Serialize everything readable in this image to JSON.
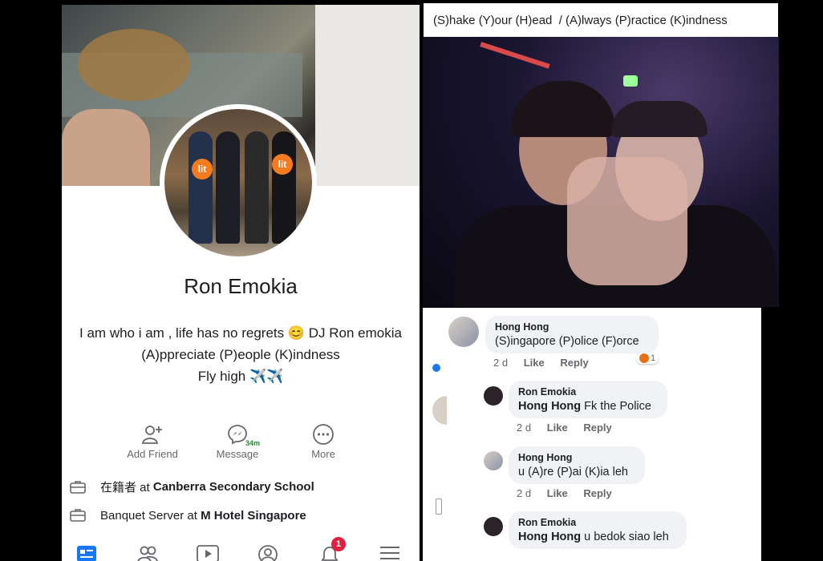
{
  "profile": {
    "name": "Ron Emokia",
    "bio_line1": "I am who i am , life has no regrets 😊 DJ Ron emokia",
    "bio_line2": "(A)ppreciate (P)eople (K)indness",
    "bio_line3": "Fly high ✈️✈️",
    "avatar_badge": "lit",
    "actions": {
      "add_friend": "Add Friend",
      "message": "Message",
      "message_badge": "34m",
      "more": "More"
    },
    "info": [
      {
        "prefix": "在籍者 at ",
        "place": "Canberra Secondary School"
      },
      {
        "prefix": "Banquet Server at ",
        "place": "M Hotel Singapore"
      }
    ],
    "notification_count": "1"
  },
  "post": {
    "caption": "(S)hake (Y)our (H)ead  / (A)lways (P)ractice (K)indness"
  },
  "comments": [
    {
      "author": "Hong Hong",
      "text": "(S)ingapore (P)olice (F)orce",
      "time": "2 d",
      "like": "Like",
      "reply": "Reply",
      "reaction_count": "1"
    },
    {
      "author": "Ron Emokia",
      "mention": "Hong Hong",
      "text": " Fk the Police",
      "time": "2 d",
      "like": "Like",
      "reply": "Reply"
    },
    {
      "author": "Hong Hong",
      "text": "u (A)re (P)ai (K)ia leh",
      "time": "2 d",
      "like": "Like",
      "reply": "Reply"
    },
    {
      "author": "Ron Emokia",
      "mention": "Hong Hong",
      "text": " u bedok siao leh"
    }
  ],
  "colors": {
    "facebook_blue": "#1877f2",
    "text": "#1c1e21",
    "muted": "#65676b",
    "bubble": "#f0f2f5",
    "notification_red": "#e41e3f"
  }
}
